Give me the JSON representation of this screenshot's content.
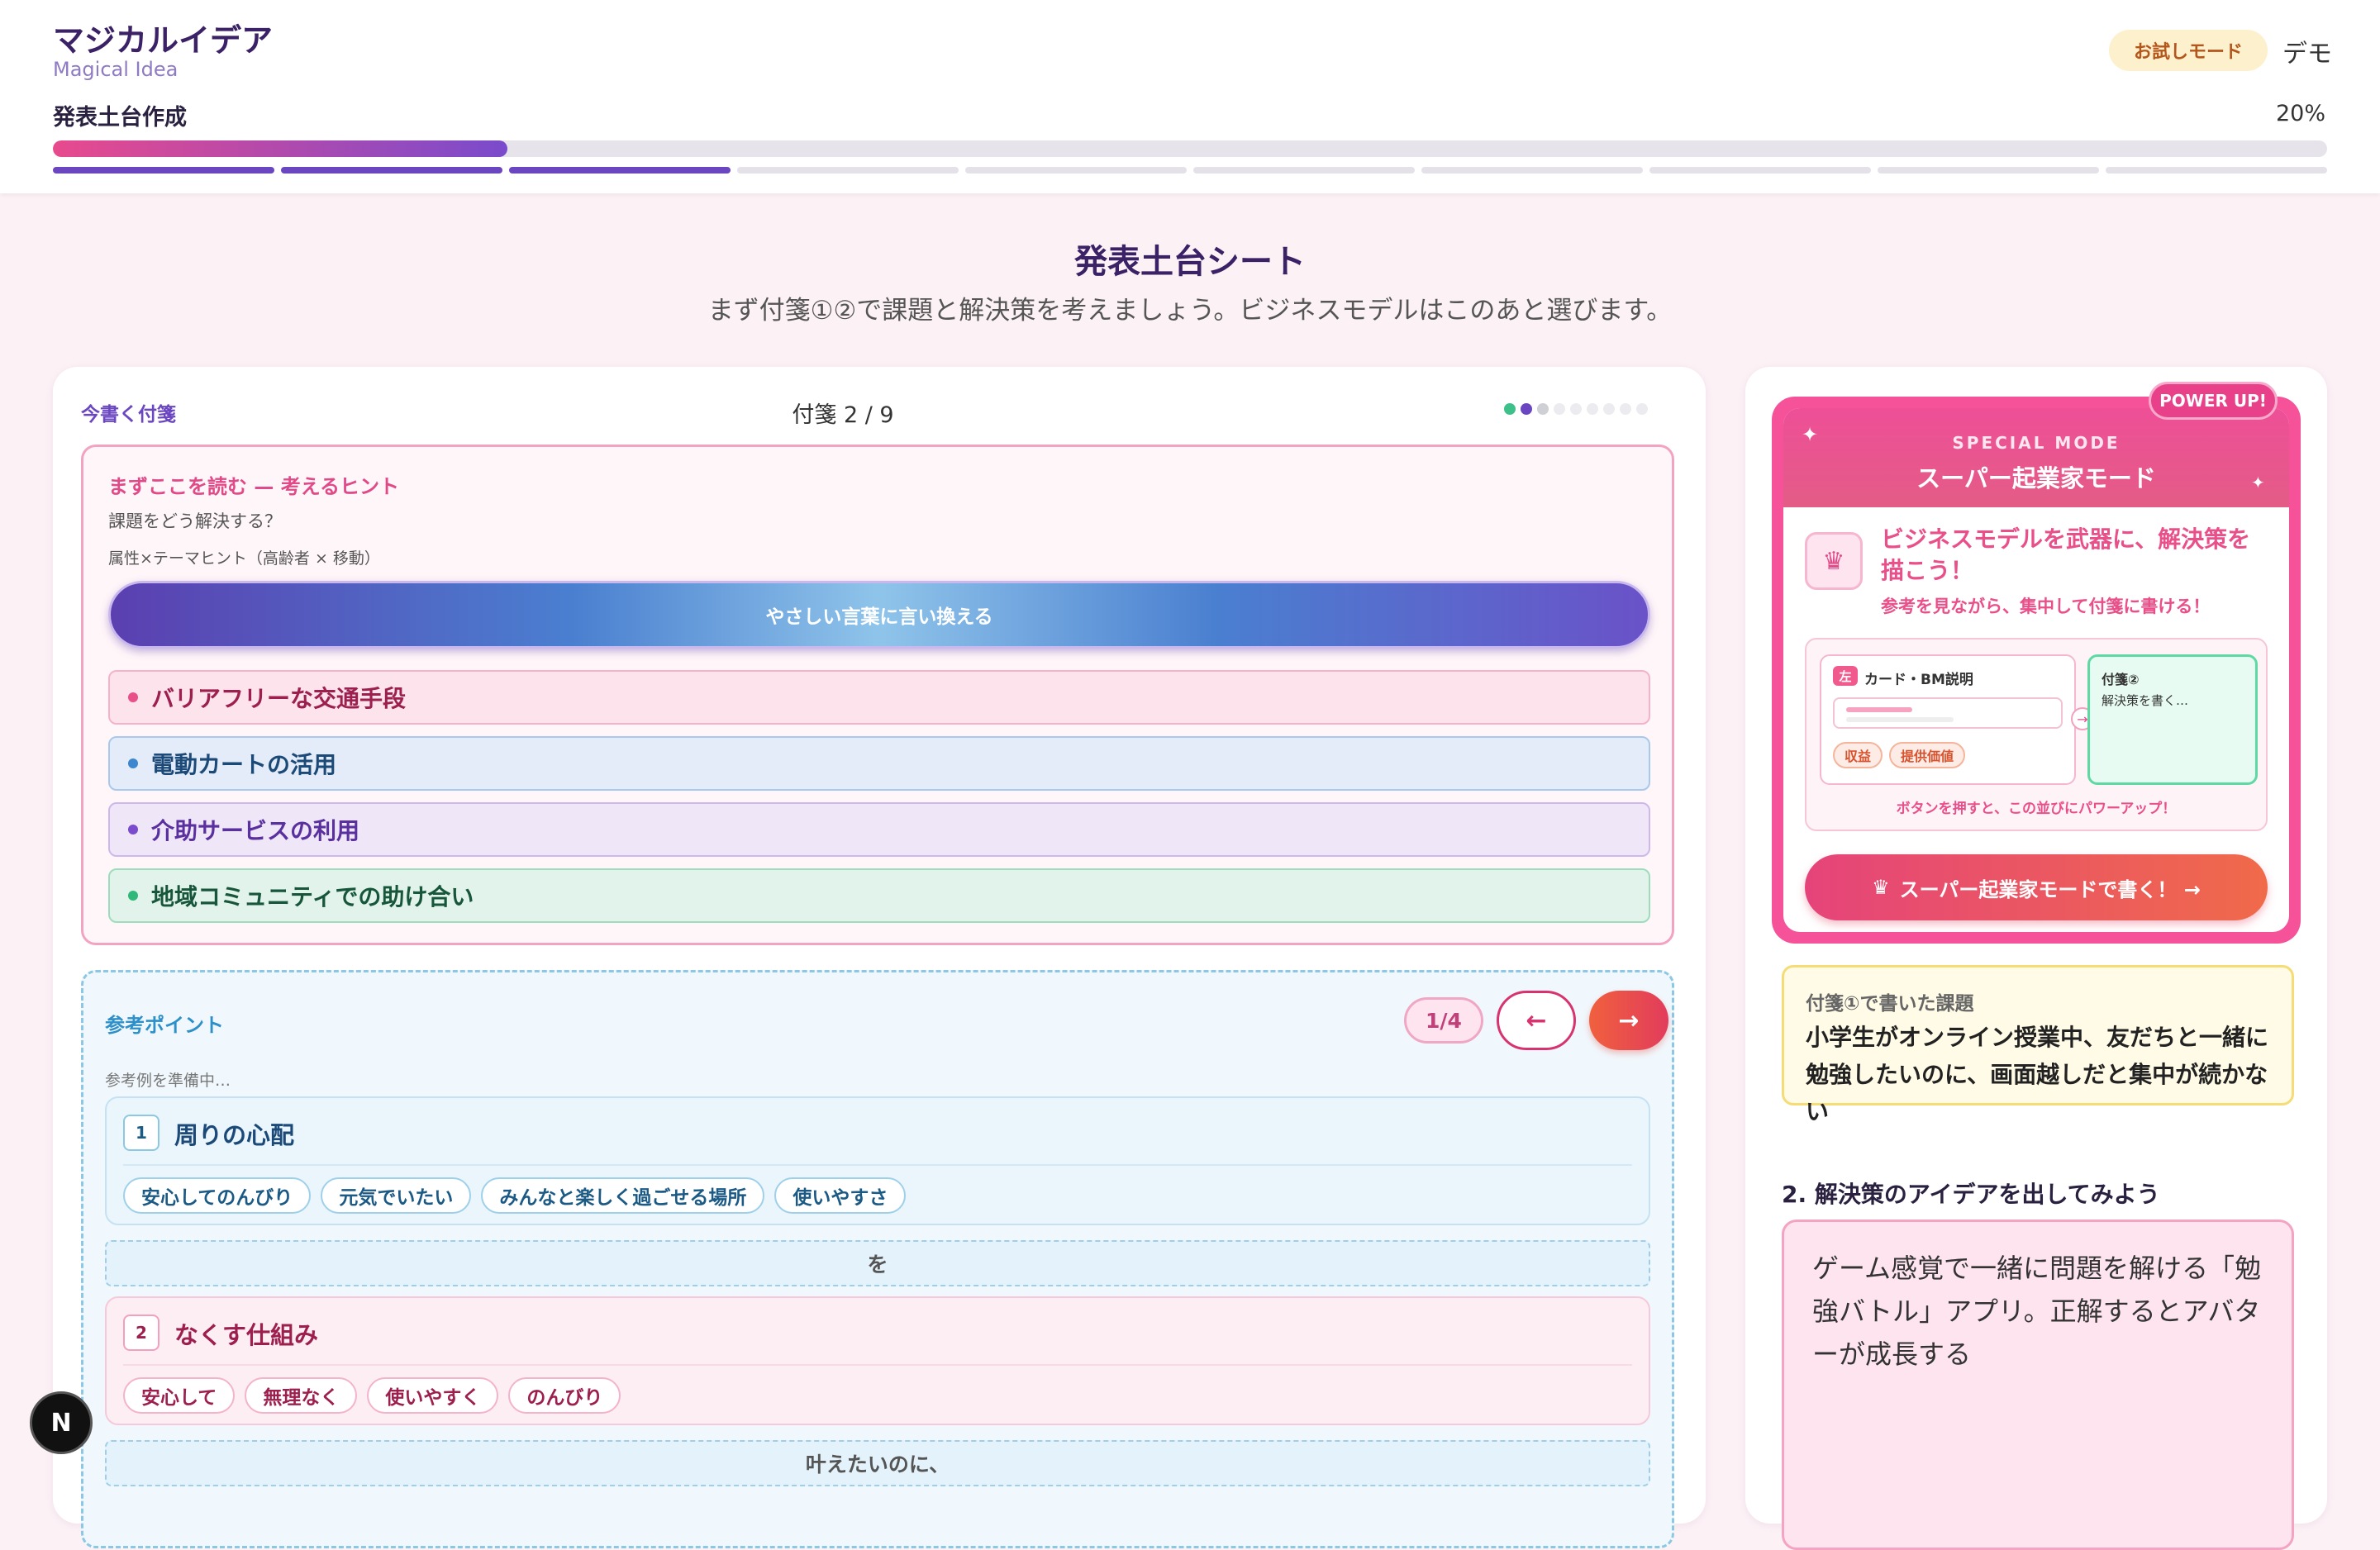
{
  "header": {
    "app_title": "マジカルイデア",
    "app_subtitle": "Magical Idea",
    "trial_badge": "お試しモード",
    "demo_label": "デモ",
    "step_title": "発表土台作成",
    "progress_percent_label": "20%",
    "progress_value": 0.2,
    "steps_total": 10,
    "steps_done": 3
  },
  "page": {
    "title": "発表土台シート",
    "description": "まず付箋①②で課題と解決策を考えましょう。ビジネスモデルはこのあと選びます。"
  },
  "sticky": {
    "now_label": "今書く付箋",
    "counter": "付箋 2 / 9",
    "dots": [
      {
        "color": "#3ec08a"
      },
      {
        "color": "#6a46c0"
      },
      {
        "color": "#cfcfd6"
      },
      {
        "color": "#ececf0"
      },
      {
        "color": "#ececf0"
      },
      {
        "color": "#ececf0"
      },
      {
        "color": "#ececf0"
      },
      {
        "color": "#ececf0"
      },
      {
        "color": "#ececf0"
      }
    ]
  },
  "hint": {
    "title": "まずここを読む — 考えるヒント",
    "question": "課題をどう解決する？",
    "attr_hint": "属性×テーマヒント（高齢者 × 移動）",
    "rephrase_button": "やさしい言葉に言い換える",
    "items": [
      {
        "text": "バリアフリーな交通手段",
        "bg": "#fde3ec",
        "border": "#f5b3c9",
        "color": "#9c1f4d",
        "bullet": "#e8508a"
      },
      {
        "text": "電動カートの活用",
        "bg": "#e3ecf8",
        "border": "#a9c9ec",
        "color": "#1c4a78",
        "bullet": "#3c86d0"
      },
      {
        "text": "介助サービスの利用",
        "bg": "#efe6f8",
        "border": "#cdb7ec",
        "color": "#5a2f9e",
        "bullet": "#7a4bcc"
      },
      {
        "text": "地域コミュニティでの助け合い",
        "bg": "#e1f3ea",
        "border": "#9fdcbe",
        "color": "#17563a",
        "bullet": "#2fb878"
      }
    ]
  },
  "reference": {
    "title": "参考ポイント",
    "page_indicator": "1/4",
    "prev_arrow": "←",
    "next_arrow": "→",
    "loading_text": "参考例を準備中…",
    "cards": [
      {
        "num": "1",
        "title": "周りの心配",
        "chips": [
          "安心してのんびり",
          "元気でいたい",
          "みんなと楽しく過ごせる場所",
          "使いやすさ"
        ]
      },
      {
        "num": "2",
        "title": "なくす仕組み",
        "chips": [
          "安心して",
          "無理なく",
          "使いやすく",
          "のんびり"
        ]
      }
    ],
    "connectors": [
      "を",
      "叶えたいのに、"
    ]
  },
  "special_mode": {
    "powerup_badge": "POWER UP!",
    "eyebrow": "SPECIAL MODE",
    "title": "スーパー起業家モード",
    "headline": "ビジネスモデルを武器に、解決策を描こう！",
    "subline": "参考を見ながら、集中して付箋に書ける！",
    "preview": {
      "left_tag": "左",
      "left_label": "カード・BM説明",
      "chips": [
        "収益",
        "提供価値"
      ],
      "right_title": "付箋②",
      "right_text": "解決策を書く…",
      "caption": "ボタンを押すと、この並びにパワーアップ！"
    },
    "cta": "スーパー起業家モードで書く！ →"
  },
  "issue": {
    "label": "付箋①で書いた課題",
    "text": "小学生がオンライン授業中、友だちと一緒に勉強したいのに、画面越しだと集中が続かない"
  },
  "solution": {
    "question": "2. 解決策のアイデアを出してみよう",
    "answer": "ゲーム感覚で一緒に問題を解ける「勉強バトル」アプリ。正解するとアバターが成長する"
  },
  "dev_badge": "N"
}
